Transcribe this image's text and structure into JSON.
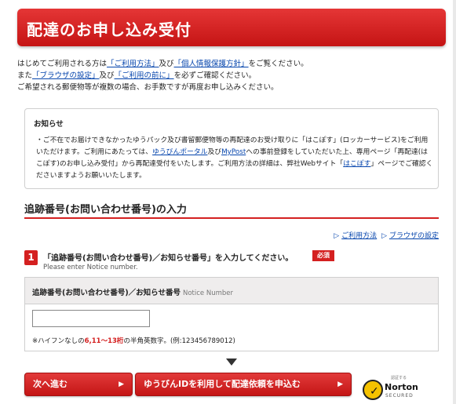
{
  "header": {
    "title": "配達のお申し込み受付"
  },
  "intro": {
    "line1_prefix": "はじめてご利用される方は",
    "line1_link1": "「ご利用方法」",
    "line1_mid": "及び",
    "line1_link2": "「個人情報保護方針」",
    "line1_suffix": "をご覧ください。",
    "line2_prefix": "また",
    "line2_link1": "「ブラウザの設定」",
    "line2_mid": "及び",
    "line2_link2": "「ご利用の前に」",
    "line2_suffix": "を必ずご確認ください。",
    "line3": "ご希望される郵便物等が複数の場合、お手数ですが再度お申し込みください。"
  },
  "notice": {
    "title": "お知らせ",
    "part1": "・ご不在でお届けできなかったゆうパック及び書留郵便物等の再配達のお受け取りに「はこぽす」(ロッカーサービス)をご利用いただけます。ご利用にあたっては、",
    "link1": "ゆうびんポータル",
    "part2": "及び",
    "link2": "MyPost",
    "part3": "への事前登録をしていただいた上、専用ページ「再配達(はこぽす)のお申し込み受付」から再配達受付をいたします。ご利用方法の詳細は、弊社Webサイト「",
    "link3": "はこぽす",
    "part4": "」ページでご確認くださいますようお願いいたします。"
  },
  "section": {
    "heading": "追跡番号(お問い合わせ番号)の入力"
  },
  "help_links": {
    "usage": "ご利用方法",
    "browser": "ブラウザの設定",
    "separator": "▷"
  },
  "step": {
    "number": "1",
    "text": "「追跡番号(お問い合わせ番号)／お知らせ番号」を入力してください。",
    "required": "必須",
    "subtext": "Please enter Notice number."
  },
  "form": {
    "label": "追跡番号(お問い合わせ番号)／お知らせ番号",
    "label_en": "Notice Number",
    "input_value": "",
    "note_prefix": "※ハイフンなしの",
    "note_highlight": "6,11～13桁",
    "note_suffix": "の半角英数字。(例:123456789012)"
  },
  "buttons": {
    "next": "次へ進む",
    "yubin": "ゆうびんIDを利用して配達依頼を申込む"
  },
  "norton": {
    "small": "認証する",
    "brand": "Norton",
    "secured": "SECURED"
  },
  "colors": {
    "accent_red": "#d42020",
    "link_blue": "#0645ad"
  }
}
